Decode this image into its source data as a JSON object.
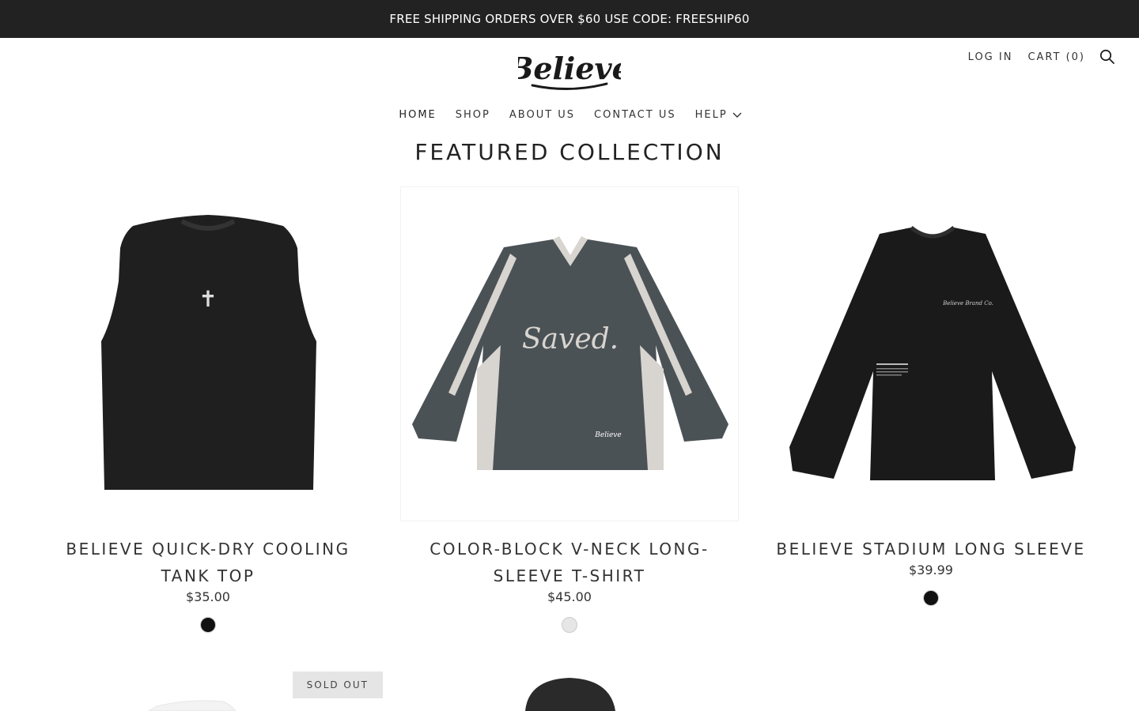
{
  "announcement": {
    "text": "FREE SHIPPING ORDERS OVER $60 USE CODE: FREESHIP60"
  },
  "header": {
    "logo_text": "Believe",
    "login_label": "LOG IN",
    "cart_label": "CART (0)",
    "search_icon": "search-icon"
  },
  "nav": {
    "items": [
      {
        "label": "HOME"
      },
      {
        "label": "SHOP"
      },
      {
        "label": "ABOUT US"
      },
      {
        "label": "CONTACT US"
      },
      {
        "label": "HELP"
      }
    ]
  },
  "section": {
    "title": "FEATURED COLLECTION"
  },
  "products": [
    {
      "title": "BELIEVE QUICK-DRY COOLING TANK TOP",
      "price": "$35.00",
      "swatch_color": "#111111",
      "graphic": "✝"
    },
    {
      "title": "COLOR-BLOCK V-NECK LONG-SLEEVE T-SHIRT",
      "price": "$45.00",
      "swatch_color": "#e6e6e6",
      "graphic": "Saved.",
      "tag": "Believe"
    },
    {
      "title": "BELIEVE STADIUM LONG SLEEVE",
      "price": "$39.99",
      "swatch_color": "#111111",
      "graphic": "Believe Brand Co."
    },
    {
      "badge": "SOLD OUT"
    },
    {}
  ],
  "colors": {
    "announcement_bg": "#222222",
    "text": "#222222"
  }
}
